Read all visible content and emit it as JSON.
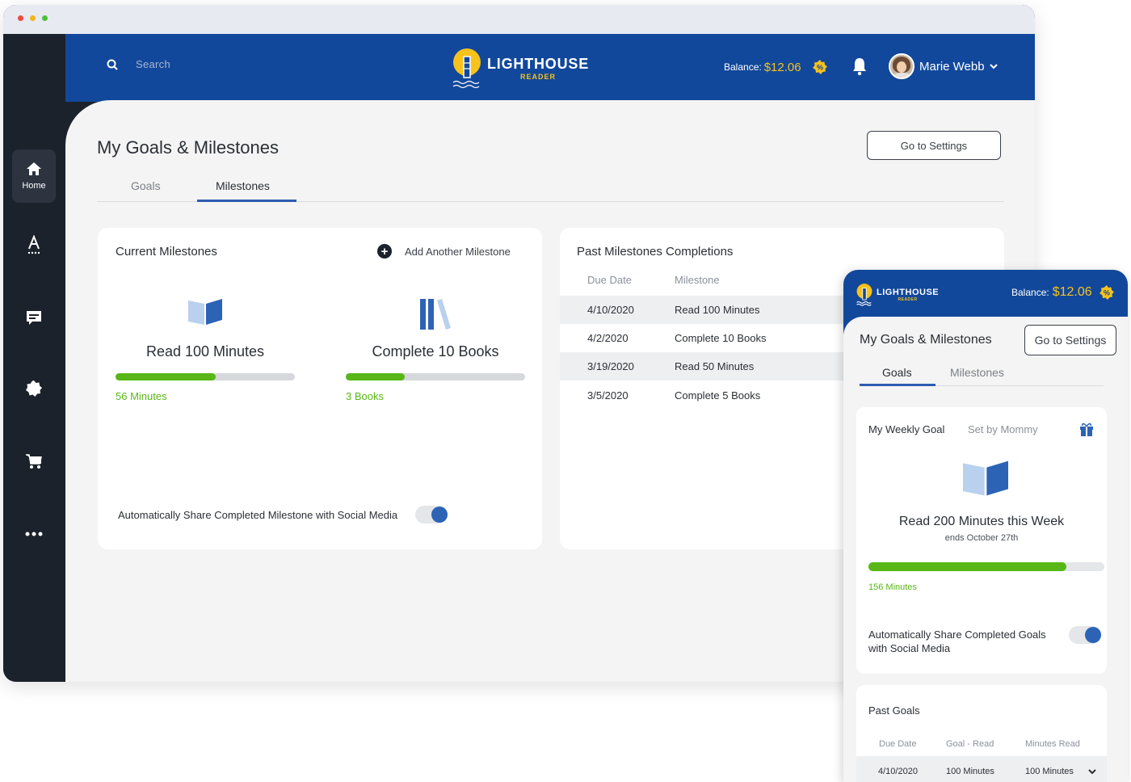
{
  "search": {
    "placeholder": "Search"
  },
  "brand": {
    "name": "LIGHTHOUSE",
    "tagline": "READER"
  },
  "balance": {
    "label": "Balance:",
    "amount": "$12.06"
  },
  "user": {
    "name": "Marie Webb"
  },
  "sidebar": {
    "items": [
      {
        "label": "Home",
        "icon": "home-icon"
      },
      {
        "icon": "text-tool-icon"
      },
      {
        "icon": "message-icon"
      },
      {
        "icon": "settings-badge-icon"
      },
      {
        "icon": "cart-icon"
      },
      {
        "icon": "more-icon"
      }
    ]
  },
  "page": {
    "title": "My Goals & Milestones",
    "settings_button": "Go to Settings",
    "tabs": [
      "Goals",
      "Milestones"
    ],
    "active_tab": "Milestones"
  },
  "current": {
    "title": "Current Milestones",
    "add_label": "Add Another Milestone",
    "items": [
      {
        "name": "Read 100 Minutes",
        "progress_label": "56 Minutes",
        "progress": 0.56,
        "icon": "open-book-icon"
      },
      {
        "name": "Complete 10 Books",
        "progress_label": "3 Books",
        "progress": 0.33,
        "icon": "books-shelf-icon"
      }
    ],
    "share_label": "Automatically Share Completed Milestone with Social Media",
    "share_enabled": true
  },
  "past": {
    "title": "Past Milestones Completions",
    "headers": [
      "Due Date",
      "Milestone"
    ],
    "rows": [
      {
        "date": "4/10/2020",
        "milestone": "Read 100 Minutes"
      },
      {
        "date": "4/2/2020",
        "milestone": "Complete 10 Books"
      },
      {
        "date": "3/19/2020",
        "milestone": "Read 50 Minutes"
      },
      {
        "date": "3/5/2020",
        "milestone": "Complete 5 Books"
      }
    ]
  },
  "mobile": {
    "title": "My Goals & Milestones",
    "settings_button": "Go to Settings",
    "tabs": [
      "Goals",
      "Milestones"
    ],
    "active_tab": "Goals",
    "weekly": {
      "title": "My Weekly Goal",
      "set_by": "Set by Mommy",
      "goal": "Read 200 Minutes this Week",
      "ends": "ends October 27th",
      "progress_label": "156 Minutes",
      "progress": 0.78,
      "share_label": "Automatically Share Completed Goals with Social Media",
      "share_enabled": true
    },
    "past_goals": {
      "title": "Past Goals",
      "headers": [
        "Due Date",
        "Goal - Read",
        "Minutes Read"
      ],
      "rows": [
        {
          "date": "4/10/2020",
          "goal": "100 Minutes",
          "read": "100 Minutes"
        }
      ]
    }
  },
  "colors": {
    "brand_blue": "#12489b",
    "accent_yellow": "#f6c21b",
    "progress_green": "#58b716",
    "sidebar_dark": "#1b222c"
  }
}
